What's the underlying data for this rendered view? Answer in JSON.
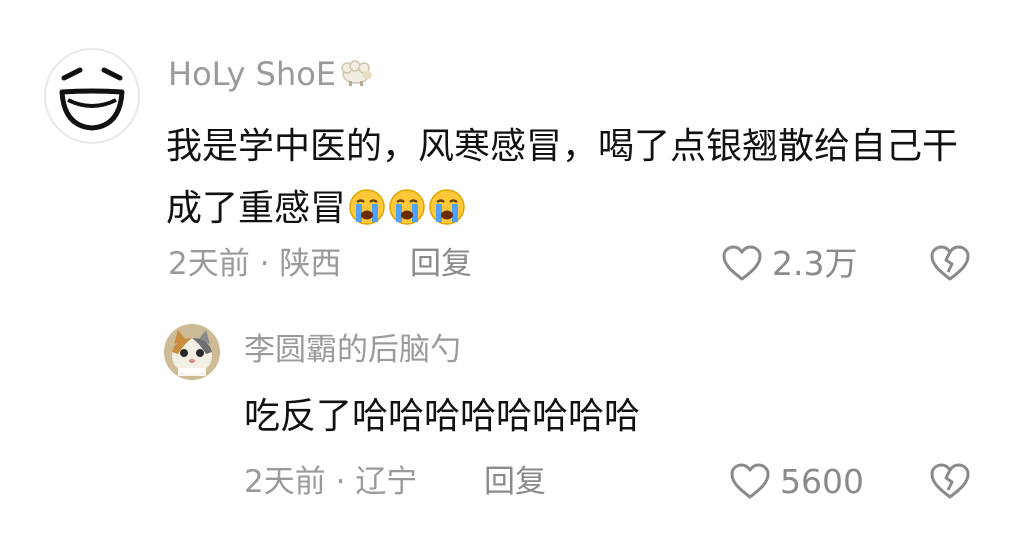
{
  "comment": {
    "username": "HoLy ShoE",
    "username_badge_icon": "sheep-icon",
    "text": "我是学中医的，风寒感冒，喝了点银翘散给自己干成了重感冒",
    "emojis": [
      "loudly-crying-face",
      "loudly-crying-face",
      "loudly-crying-face"
    ],
    "time": "2天前",
    "separator": "·",
    "location": "陕西",
    "reply_label": "回复",
    "like_count": "2.3万",
    "like_icon": "heart-outline-icon",
    "dislike_icon": "broken-heart-icon"
  },
  "reply": {
    "username": "李圆霸的后脑勺",
    "avatar_icon": "cat-avatar",
    "text": "吃反了哈哈哈哈哈哈哈哈",
    "time": "2天前",
    "separator": "·",
    "location": "辽宁",
    "reply_label": "回复",
    "like_count": "5600",
    "like_icon": "heart-outline-icon",
    "dislike_icon": "broken-heart-icon"
  },
  "colors": {
    "text_primary": "#111111",
    "text_secondary": "#9a9a9a",
    "background": "#ffffff"
  }
}
